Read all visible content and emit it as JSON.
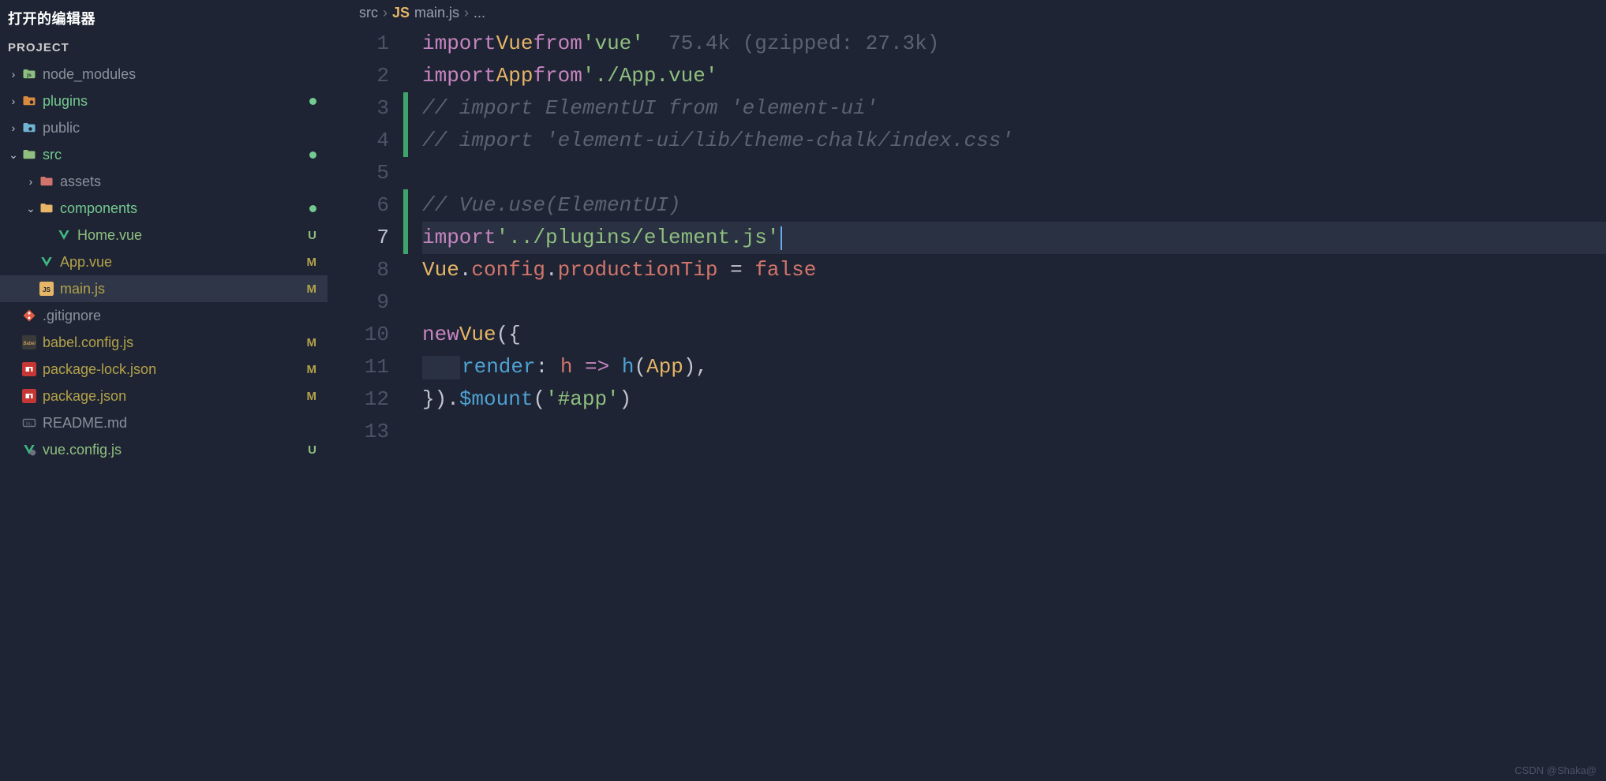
{
  "sidebar": {
    "openEditorsTitle": "打开的编辑器",
    "projectTitle": "PROJECT",
    "items": [
      {
        "name": "node_modules",
        "kind": "folder-node",
        "indent": 0,
        "chev": "right",
        "badge": "",
        "color": "",
        "active": false
      },
      {
        "name": "plugins",
        "kind": "folder-plugin",
        "indent": 0,
        "chev": "right",
        "badge": "dot",
        "color": "greentext",
        "active": false
      },
      {
        "name": "public",
        "kind": "folder-public",
        "indent": 0,
        "chev": "right",
        "badge": "",
        "color": "",
        "active": false
      },
      {
        "name": "src",
        "kind": "folder-src",
        "indent": 0,
        "chev": "down",
        "badge": "dot",
        "color": "greentext",
        "active": false
      },
      {
        "name": "assets",
        "kind": "folder-assets",
        "indent": 1,
        "chev": "right",
        "badge": "",
        "color": "",
        "active": false
      },
      {
        "name": "components",
        "kind": "folder-components",
        "indent": 1,
        "chev": "down",
        "badge": "dot",
        "color": "greentext",
        "active": false
      },
      {
        "name": "Home.vue",
        "kind": "vue",
        "indent": 2,
        "chev": "none",
        "badge": "U",
        "color": "green",
        "active": false
      },
      {
        "name": "App.vue",
        "kind": "vue",
        "indent": 1,
        "chev": "none",
        "badge": "M",
        "color": "olive",
        "active": false
      },
      {
        "name": "main.js",
        "kind": "js",
        "indent": 1,
        "chev": "none",
        "badge": "M",
        "color": "olive",
        "active": true
      },
      {
        "name": ".gitignore",
        "kind": "git",
        "indent": 0,
        "chev": "none",
        "badge": "",
        "color": "",
        "active": false
      },
      {
        "name": "babel.config.js",
        "kind": "babel",
        "indent": 0,
        "chev": "none",
        "badge": "M",
        "color": "olive",
        "active": false
      },
      {
        "name": "package-lock.json",
        "kind": "npm",
        "indent": 0,
        "chev": "none",
        "badge": "M",
        "color": "olive",
        "active": false
      },
      {
        "name": "package.json",
        "kind": "npm",
        "indent": 0,
        "chev": "none",
        "badge": "M",
        "color": "olive",
        "active": false
      },
      {
        "name": "README.md",
        "kind": "md",
        "indent": 0,
        "chev": "none",
        "badge": "",
        "color": "",
        "active": false
      },
      {
        "name": "vue.config.js",
        "kind": "vueconf",
        "indent": 0,
        "chev": "none",
        "badge": "U",
        "color": "green",
        "active": false
      }
    ]
  },
  "breadcrumb": {
    "seg1": "src",
    "seg2": "main.js",
    "seg3": "...",
    "lang": "JS"
  },
  "editor": {
    "activeLine": 7,
    "lines": 13,
    "diff": {
      "modified": [
        3,
        4,
        6,
        7
      ]
    },
    "hint": "75.4k (gzipped: 27.3k)",
    "code": {
      "l1": {
        "a": "import",
        "b": "Vue",
        "c": "from",
        "d": "'vue'"
      },
      "l2": {
        "a": "import",
        "b": "App",
        "c": "from",
        "d": "'./App.vue'"
      },
      "l3": "// import ElementUI from 'element-ui'",
      "l4": "// import 'element-ui/lib/theme-chalk/index.css'",
      "l6": "// Vue.use(ElementUI)",
      "l7": {
        "a": "import",
        "d": "'../plugins/element.js'"
      },
      "l8": {
        "a": "Vue",
        "b": ".",
        "c": "config",
        "d": ".",
        "e": "productionTip",
        "f": " = ",
        "g": "false"
      },
      "l10": {
        "a": "new",
        "b": "Vue",
        "c": "({"
      },
      "l11": {
        "a": "render",
        "b": ": ",
        "c": "h",
        "d": " => ",
        "e": "h",
        "f": "(",
        "g": "App",
        "h": "),"
      },
      "l12": {
        "a": "}).",
        "b": "$mount",
        "c": "(",
        "d": "'#app'",
        "e": ")"
      }
    }
  },
  "watermark": "CSDN @Shaka@"
}
